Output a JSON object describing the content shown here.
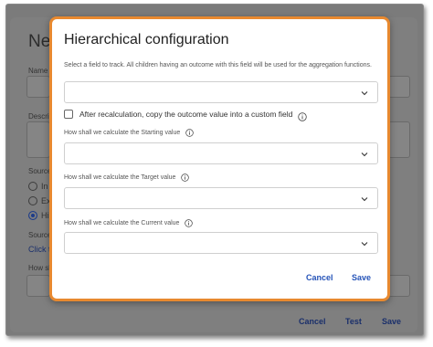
{
  "background_dialog": {
    "title": "New",
    "labels": [
      "Name",
      "Descri",
      "Source",
      "Source",
      "How sh"
    ],
    "radio_options": [
      "In",
      "Ex",
      "Hi"
    ],
    "link_text": "Click t",
    "buttons": {
      "cancel": "Cancel",
      "test": "Test",
      "save": "Save"
    }
  },
  "modal": {
    "title": "Hierarchical configuration",
    "description": "Select a field to track. All children having an outcome with this field will be used for the aggregation functions.",
    "field_select": {
      "value": ""
    },
    "checkbox": {
      "label": "After recalculation, copy the outcome value into a custom field",
      "checked": false
    },
    "starting_value": {
      "label": "How shall we calculate the Starting value",
      "value": ""
    },
    "target_value": {
      "label": "How shall we calculate the Target value",
      "value": ""
    },
    "current_value": {
      "label": "How shall we calculate the Current value",
      "value": ""
    },
    "buttons": {
      "cancel": "Cancel",
      "save": "Save"
    }
  },
  "colors": {
    "accent_border": "#e8892f",
    "button_text": "#2553b8",
    "overlay": "#7b7b7b"
  }
}
